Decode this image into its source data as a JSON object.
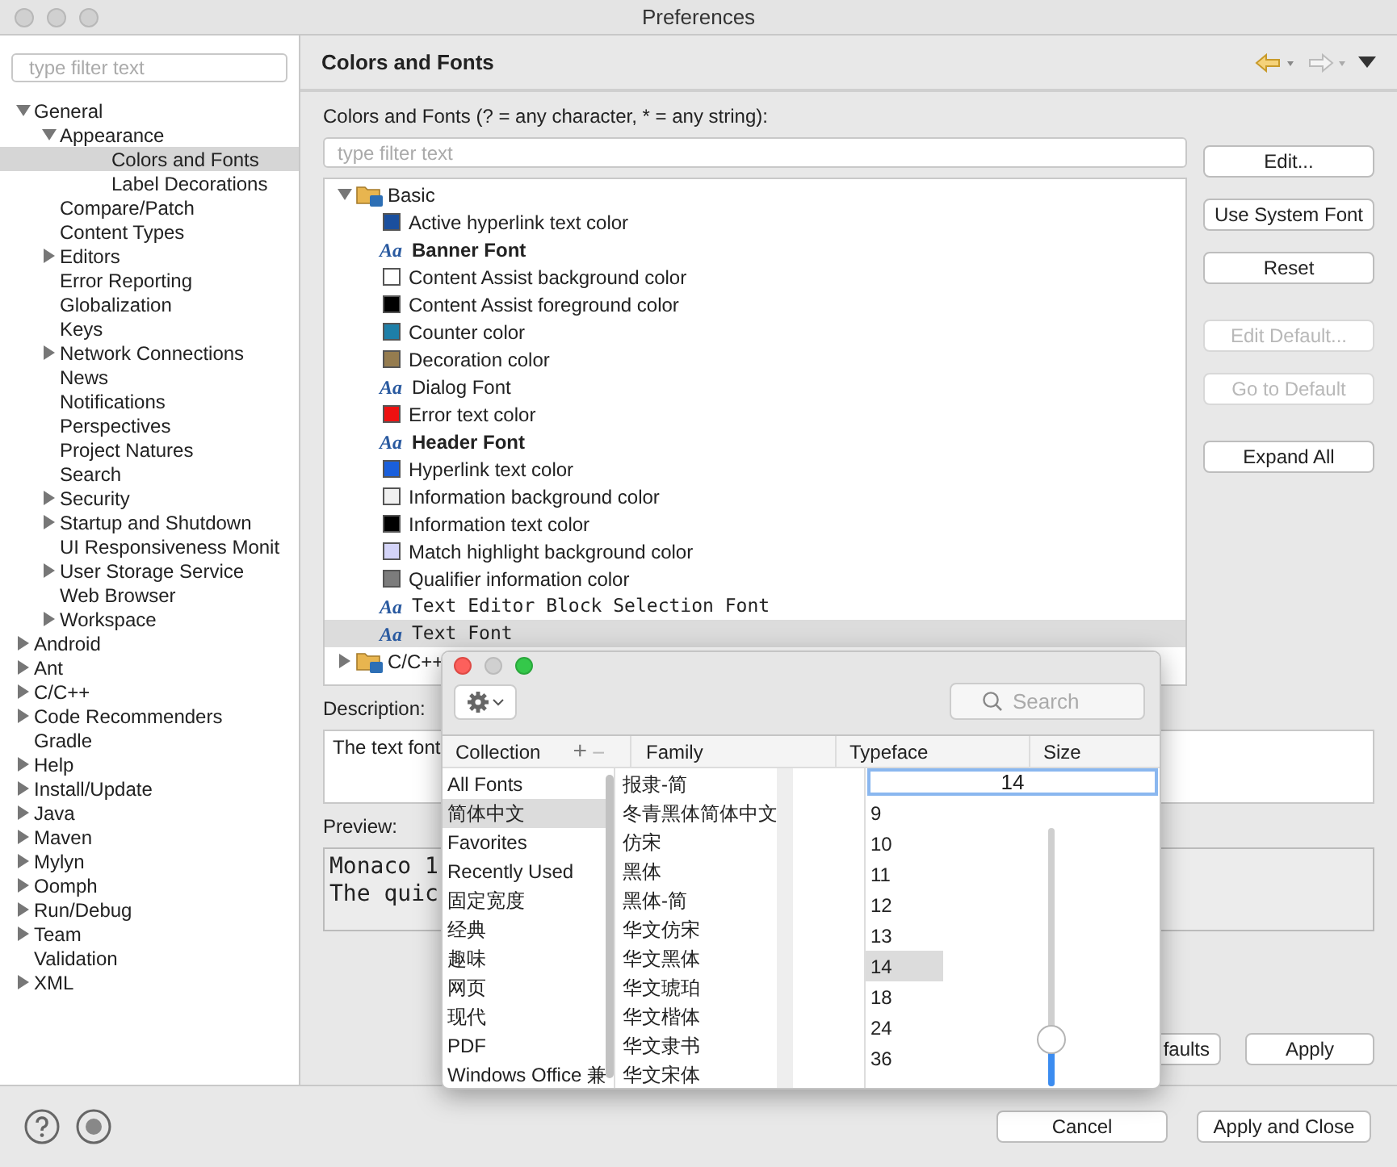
{
  "window": {
    "title": "Preferences"
  },
  "sidebar": {
    "filter": {
      "placeholder": "type filter text"
    },
    "items": [
      {
        "label": "General",
        "expanded": true,
        "selected": false,
        "children": [
          {
            "label": "Appearance",
            "expanded": true,
            "selected": false,
            "children": [
              {
                "label": "Colors and Fonts",
                "selected": true
              },
              {
                "label": "Label Decorations",
                "selected": false
              }
            ]
          },
          {
            "label": "Compare/Patch",
            "selected": false
          },
          {
            "label": "Content Types",
            "selected": false
          },
          {
            "label": "Editors",
            "expanded": false,
            "selected": false
          },
          {
            "label": "Error Reporting",
            "selected": false
          },
          {
            "label": "Globalization",
            "selected": false
          },
          {
            "label": "Keys",
            "selected": false
          },
          {
            "label": "Network Connections",
            "expanded": false,
            "selected": false
          },
          {
            "label": "News",
            "selected": false
          },
          {
            "label": "Notifications",
            "selected": false
          },
          {
            "label": "Perspectives",
            "selected": false
          },
          {
            "label": "Project Natures",
            "selected": false
          },
          {
            "label": "Search",
            "selected": false
          },
          {
            "label": "Security",
            "expanded": false,
            "selected": false
          },
          {
            "label": "Startup and Shutdown",
            "expanded": false,
            "selected": false
          },
          {
            "label": "UI Responsiveness Monit",
            "selected": false
          },
          {
            "label": "User Storage Service",
            "expanded": false,
            "selected": false
          },
          {
            "label": "Web Browser",
            "selected": false
          },
          {
            "label": "Workspace",
            "expanded": false,
            "selected": false
          }
        ]
      },
      {
        "label": "Android",
        "expanded": false,
        "selected": false
      },
      {
        "label": "Ant",
        "expanded": false,
        "selected": false
      },
      {
        "label": "C/C++",
        "expanded": false,
        "selected": false
      },
      {
        "label": "Code Recommenders",
        "expanded": false,
        "selected": false
      },
      {
        "label": "Gradle",
        "selected": false
      },
      {
        "label": "Help",
        "expanded": false,
        "selected": false
      },
      {
        "label": "Install/Update",
        "expanded": false,
        "selected": false
      },
      {
        "label": "Java",
        "expanded": false,
        "selected": false
      },
      {
        "label": "Maven",
        "expanded": false,
        "selected": false
      },
      {
        "label": "Mylyn",
        "expanded": false,
        "selected": false
      },
      {
        "label": "Oomph",
        "expanded": false,
        "selected": false
      },
      {
        "label": "Run/Debug",
        "expanded": false,
        "selected": false
      },
      {
        "label": "Team",
        "expanded": false,
        "selected": false
      },
      {
        "label": "Validation",
        "selected": false
      },
      {
        "label": "XML",
        "expanded": false,
        "selected": false
      }
    ]
  },
  "page": {
    "title": "Colors and Fonts",
    "filter_label": "Colors and Fonts (? = any character, * = any string):",
    "filter": {
      "placeholder": "type filter text"
    },
    "tree": [
      {
        "label": "Basic",
        "expanded": true,
        "children": [
          {
            "kind": "color",
            "label": "Active hyperlink text color",
            "color": "#1a4f9e",
            "selected": false
          },
          {
            "kind": "bold_font",
            "icon": "Aa",
            "label": "Banner Font",
            "selected": false
          },
          {
            "kind": "color",
            "label": "Content Assist background color",
            "color": "#ffffff",
            "selected": false
          },
          {
            "kind": "color",
            "label": "Content Assist foreground color",
            "color": "#000000",
            "selected": false
          },
          {
            "kind": "color",
            "label": "Counter color",
            "color": "#1e7fa8",
            "selected": false
          },
          {
            "kind": "color",
            "label": "Decoration color",
            "color": "#957c4f",
            "selected": false
          },
          {
            "kind": "font",
            "icon": "Aa",
            "label": "Dialog Font",
            "selected": false
          },
          {
            "kind": "color",
            "label": "Error text color",
            "color": "#ee1111",
            "selected": false
          },
          {
            "kind": "bold_font",
            "icon": "Aa",
            "label": "Header Font",
            "selected": false
          },
          {
            "kind": "color",
            "label": "Hyperlink text color",
            "color": "#1a5fdc",
            "selected": false
          },
          {
            "kind": "color",
            "label": "Information background color",
            "color": "#f0f0f0",
            "selected": false
          },
          {
            "kind": "color",
            "label": "Information text color",
            "color": "#000000",
            "selected": false
          },
          {
            "kind": "color",
            "label": "Match highlight background color",
            "color": "#d4d4f8",
            "selected": false
          },
          {
            "kind": "color",
            "label": "Qualifier information color",
            "color": "#7c7c7c",
            "selected": false
          },
          {
            "kind": "mono_font",
            "icon": "Aa",
            "label": "Text Editor Block Selection Font",
            "selected": false
          },
          {
            "kind": "mono_font",
            "icon": "Aa",
            "label": "Text Font",
            "selected": true
          }
        ]
      },
      {
        "label": "C/C++",
        "expanded": false
      }
    ],
    "buttons": [
      {
        "label": "Edit...",
        "disabled": false
      },
      {
        "label": "Use System Font",
        "disabled": false
      },
      {
        "label": "Reset",
        "disabled": false
      },
      {
        "label": "Edit Default...",
        "disabled": true
      },
      {
        "label": "Go to Default",
        "disabled": true
      },
      {
        "label": "Expand All",
        "disabled": false
      }
    ],
    "description_label": "Description:",
    "description": "The text font",
    "preview_label": "Preview:",
    "preview": [
      "Monaco 1",
      "The quic"
    ],
    "restore_button": "faults",
    "apply_button": "Apply"
  },
  "footer": {
    "cancel": "Cancel",
    "apply_close": "Apply and Close"
  },
  "font_panel": {
    "search": {
      "placeholder": "Search"
    },
    "headers": {
      "collection": "Collection",
      "add": "+",
      "remove": "−",
      "family": "Family",
      "typeface": "Typeface",
      "size": "Size"
    },
    "collections": [
      {
        "label": "All Fonts",
        "selected": false
      },
      {
        "label": "简体中文",
        "selected": true
      },
      {
        "label": "Favorites",
        "selected": false
      },
      {
        "label": "Recently Used",
        "selected": false
      },
      {
        "label": "固定宽度",
        "selected": false
      },
      {
        "label": "经典",
        "selected": false
      },
      {
        "label": "趣味",
        "selected": false
      },
      {
        "label": "网页",
        "selected": false
      },
      {
        "label": "现代",
        "selected": false
      },
      {
        "label": "PDF",
        "selected": false
      },
      {
        "label": "Windows Office 兼",
        "selected": false
      }
    ],
    "families": [
      "报隶-简",
      "冬青黑体简体中文",
      "仿宋",
      "黑体",
      "黑体-简",
      "华文仿宋",
      "华文黑体",
      "华文琥珀",
      "华文楷体",
      "华文隶书",
      "华文宋体"
    ],
    "size_value": "14",
    "sizes": [
      {
        "label": "9",
        "selected": false
      },
      {
        "label": "10",
        "selected": false
      },
      {
        "label": "11",
        "selected": false
      },
      {
        "label": "12",
        "selected": false
      },
      {
        "label": "13",
        "selected": false
      },
      {
        "label": "14",
        "selected": true
      },
      {
        "label": "18",
        "selected": false
      },
      {
        "label": "24",
        "selected": false
      },
      {
        "label": "36",
        "selected": false
      }
    ],
    "slider": {
      "level": 0.18
    }
  }
}
